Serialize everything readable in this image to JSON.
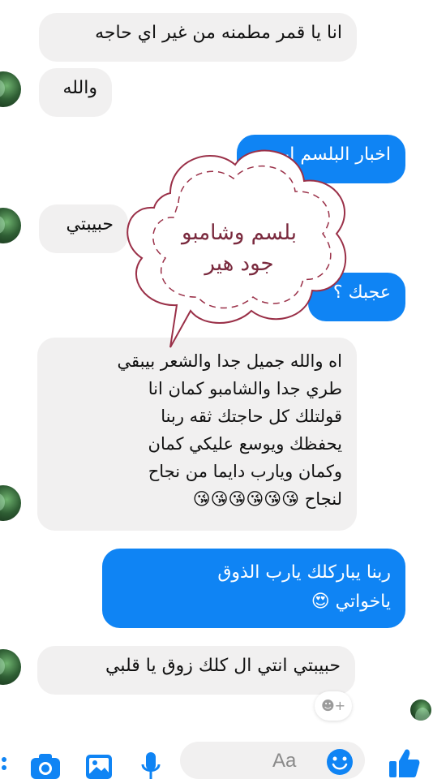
{
  "messages": [
    {
      "sender": "other",
      "text": "انا يا قمر مطمنه من غير اي حاجه"
    },
    {
      "sender": "other",
      "text": "والله"
    },
    {
      "sender": "me",
      "text": "اخبار البلسم ايه"
    },
    {
      "sender": "other",
      "text": "حبيبتي"
    },
    {
      "sender": "me",
      "text": "عجبك ؟"
    },
    {
      "sender": "other",
      "text": "اه والله جميل جدا والشعر بيبقي\nطري  جدا والشامبو كمان انا\nقولتلك كل حاجتك ثقه ربنا\nيحفظك ويوسع عليكي كمان\nوكمان ويارب دايما من نجاح\nلنجاح 😘😘😘😘😘😘"
    },
    {
      "sender": "me",
      "text": "ربنا يباركلك يارب الذوق\nياخواتي 😍"
    },
    {
      "sender": "other",
      "text": "حبيبتي انتي ال كلك زوق يا قلبي"
    }
  ],
  "overlay": {
    "text": "بلسم وشامبو\nجود هير"
  },
  "composer": {
    "placeholder": "Aa"
  },
  "reaction": {
    "label": "☻+"
  },
  "icons": {
    "camera": "camera-icon",
    "gallery": "image-icon",
    "mic": "microphone-icon",
    "emoji": "emoji-icon",
    "like": "thumbs-up-icon"
  },
  "colors": {
    "accent": "#0f84f4",
    "received_bubble": "#f1f0f0"
  }
}
